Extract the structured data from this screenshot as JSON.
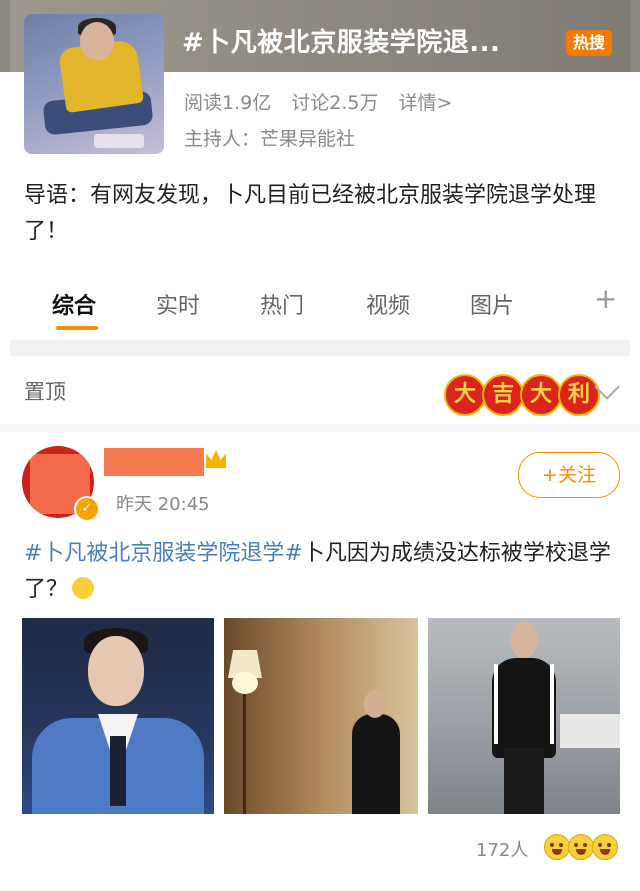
{
  "topic": {
    "title": "#卜凡被北京服装学院退...",
    "badge": "热搜",
    "reads": "阅读1.9亿",
    "discussions": "讨论2.5万",
    "details": "详情>",
    "host": "主持人：芒果异能社",
    "intro": "导语：有网友发现，卜凡目前已经被北京服装学院退学处理了！"
  },
  "tabs": [
    "综合",
    "实时",
    "热门",
    "视频",
    "图片"
  ],
  "tab_add": "+",
  "active_tab": "综合",
  "pinned": {
    "label": "置顶",
    "lucky_chars": [
      "大",
      "吉",
      "大",
      "利"
    ]
  },
  "post": {
    "time": "昨天 20:45",
    "follow_label": "+关注",
    "hashtag": "#卜凡被北京服装学院退学#",
    "text": "卜凡因为成绩没达标被学校退学了？",
    "reaction_count": "172人"
  },
  "colors": {
    "accent": "#f29000",
    "hot_badge": "#f57a00",
    "link": "#4a7fbf"
  },
  "icons": [
    "chevron-down-icon",
    "verified-icon",
    "crown-icon",
    "emoji-icon"
  ]
}
